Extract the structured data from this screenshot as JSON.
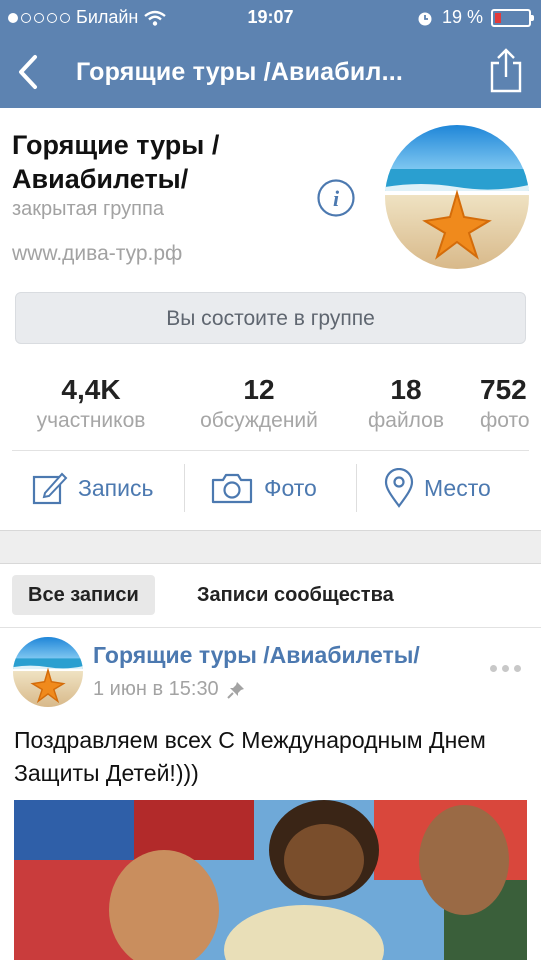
{
  "status_bar": {
    "carrier": "Билайн",
    "time": "19:07",
    "battery": "19 %",
    "signal_icon": "signal-dots-icon",
    "wifi_icon": "wifi-icon",
    "alarm_icon": "alarm-icon",
    "battery_level": 0.19
  },
  "nav": {
    "title": "Горящие туры /Авиабил...",
    "back_icon": "chevron-left-icon",
    "share_icon": "share-icon"
  },
  "group": {
    "name": "Горящие туры / Авиабилеты/",
    "type": "закрытая группа",
    "url": "www.дива-тур.рф",
    "info_icon": "info-icon",
    "member_button": "Вы состоите в группе"
  },
  "counters": [
    {
      "value": "4,4K",
      "label": "участников"
    },
    {
      "value": "12",
      "label": "обсуждений"
    },
    {
      "value": "18",
      "label": "файлов"
    },
    {
      "value": "752",
      "label": "фото"
    }
  ],
  "actions": [
    {
      "label": "Запись",
      "icon": "compose-icon"
    },
    {
      "label": "Фото",
      "icon": "camera-icon"
    },
    {
      "label": "Место",
      "icon": "location-pin-icon"
    }
  ],
  "tabs": {
    "all": "Все записи",
    "community": "Записи сообщества"
  },
  "post": {
    "author": "Горящие туры /Авиабилеты/",
    "time": "1 июн в 15:30",
    "text": "Поздравляем всех С Международным Днем Защиты Детей!)))",
    "pin_icon": "pin-icon",
    "menu_icon": "more-dots-icon"
  },
  "colors": {
    "header": "#5d83b1",
    "accent": "#4c79b0"
  }
}
